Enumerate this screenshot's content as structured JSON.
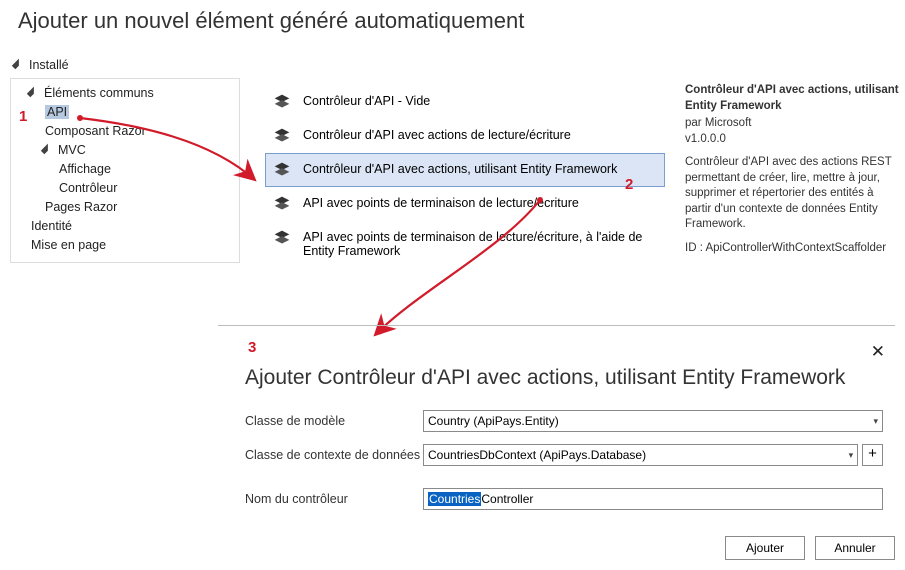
{
  "window_title": "Ajouter un nouvel élément généré automatiquement",
  "tree": {
    "installed": "Installé",
    "common_elements": "Éléments communs",
    "api": "API",
    "razor_component": "Composant Razor",
    "mvc": "MVC",
    "view": "Affichage",
    "controller": "Contrôleur",
    "razor_pages": "Pages Razor",
    "identity": "Identité",
    "layout": "Mise en page"
  },
  "templates": {
    "t0": "Contrôleur d'API - Vide",
    "t1": "Contrôleur d'API avec actions de lecture/écriture",
    "t2": "Contrôleur d'API avec actions, utilisant Entity Framework",
    "t3": "API avec points de terminaison de lecture/écriture",
    "t4": "API avec points de terminaison de lecture/écriture, à l'aide de Entity Framework"
  },
  "details": {
    "title": "Contrôleur d'API avec actions, utilisant Entity Framework",
    "author": "par Microsoft",
    "version": "v1.0.0.0",
    "description": "Contrôleur d'API avec des actions REST permettant de créer, lire, mettre à jour, supprimer et répertorier des entités à partir d'un contexte de données Entity Framework.",
    "id_label": "ID : ApiControllerWithContextScaffolder"
  },
  "annotations": {
    "n1": "1",
    "n2": "2",
    "n3": "3"
  },
  "dialog2": {
    "title": "Ajouter Contrôleur d'API avec actions, utilisant Entity Framework",
    "model_label": "Classe de modèle",
    "model_value": "Country (ApiPays.Entity)",
    "context_label": "Classe de contexte de données",
    "context_value": "CountriesDbContext (ApiPays.Database)",
    "controller_label": "Nom du contrôleur",
    "controller_value_selected": "Countries",
    "controller_value_rest": "Controller",
    "add_btn": "Ajouter",
    "cancel_btn": "Annuler",
    "plus": "+"
  }
}
